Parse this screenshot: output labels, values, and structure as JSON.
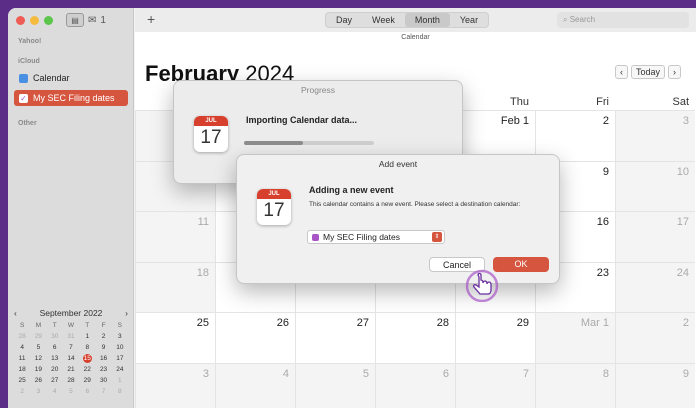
{
  "colors": {
    "accent": "#d6553e",
    "frame": "#5b2d86",
    "today": "#d6402d",
    "calendar_check": "#4a90e2",
    "sec_check": "#a855c8"
  },
  "toolbar": {
    "mailbox_count": "1",
    "views": [
      "Day",
      "Week",
      "Month",
      "Year"
    ],
    "selected_view": "Month",
    "search_placeholder": "Search",
    "subtitle": "Calendar"
  },
  "sidebar": {
    "sections": {
      "yahoo": "Yahoo!",
      "icloud": "iCloud",
      "other": "Other"
    },
    "items": [
      {
        "label": "Calendar",
        "checked": false
      },
      {
        "label": "My SEC Filing dates",
        "checked": true
      }
    ],
    "mini_calendar": {
      "title": "September 2022",
      "dows": [
        "S",
        "M",
        "T",
        "W",
        "T",
        "F",
        "S"
      ],
      "weeks": [
        [
          "28",
          "29",
          "30",
          "31",
          "1",
          "2",
          "3"
        ],
        [
          "4",
          "5",
          "6",
          "7",
          "8",
          "9",
          "10"
        ],
        [
          "11",
          "12",
          "13",
          "14",
          "15",
          "16",
          "17"
        ],
        [
          "18",
          "19",
          "20",
          "21",
          "22",
          "23",
          "24"
        ],
        [
          "25",
          "26",
          "27",
          "28",
          "29",
          "30",
          "1"
        ],
        [
          "2",
          "3",
          "4",
          "5",
          "6",
          "7",
          "8"
        ]
      ],
      "today": "15"
    }
  },
  "main": {
    "month": "February",
    "year": "2024",
    "today_button": "Today",
    "day_headers": [
      "Thu",
      "Fri",
      "Sat"
    ],
    "weeks": [
      [
        "",
        "",
        "",
        "",
        "Feb 1",
        "2",
        "3"
      ],
      [
        "",
        "",
        "",
        "",
        "",
        "9",
        "10"
      ],
      [
        "11",
        "",
        "",
        "",
        "",
        "16",
        "17"
      ],
      [
        "18",
        "",
        "",
        "",
        "",
        "23",
        "24"
      ],
      [
        "25",
        "26",
        "27",
        "28",
        "29",
        "Mar 1",
        "2"
      ],
      [
        "3",
        "4",
        "5",
        "6",
        "7",
        "8",
        "9"
      ]
    ]
  },
  "progress_dialog": {
    "title": "Progress",
    "message": "Importing Calendar data...",
    "icon_month": "JUL",
    "icon_day": "17",
    "progress": 0.45
  },
  "add_event_dialog": {
    "title": "Add event",
    "heading": "Adding a new event",
    "body": "This calendar contains a new event. Please select a destination calendar:",
    "selected_calendar": "My SEC Filing dates",
    "cancel_label": "Cancel",
    "ok_label": "OK",
    "icon_month": "JUL",
    "icon_day": "17"
  }
}
